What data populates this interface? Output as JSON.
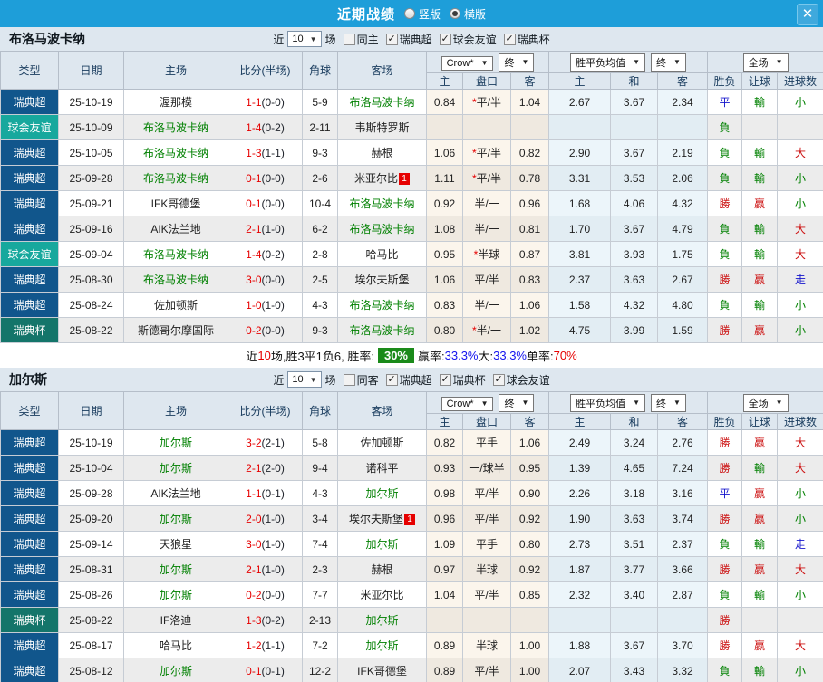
{
  "dialog": {
    "title": "近期战绩",
    "layout_options": [
      {
        "label": "竖版",
        "selected": false
      },
      {
        "label": "横版",
        "selected": true
      }
    ],
    "close_label": "✕"
  },
  "colors": {
    "titlebar": "#1e9ed9",
    "band": "#dee7ef",
    "league_super": "#11568c",
    "league_friendly": "#17a89d",
    "league_cup": "#14756a",
    "win_red": "#cc1111",
    "lose_green": "#008000",
    "draw_blue": "#1414cc",
    "rate_badge_green": "#1a8a1a"
  },
  "columns": {
    "main": [
      "类型",
      "日期",
      "主场",
      "比分(半场)",
      "角球",
      "客场"
    ],
    "crown_select": "Crow*",
    "final_select": "终",
    "avg_select": "胜平负均值",
    "full_select": "全场",
    "crown_subs": [
      "主",
      "盘口",
      "客"
    ],
    "avg_subs": [
      "主",
      "和",
      "客"
    ],
    "full_subs": [
      "胜负",
      "让球",
      "进球数"
    ]
  },
  "sections": [
    {
      "team": "布洛马波卡纳",
      "filter": {
        "prefix": "近",
        "count": "10",
        "suffix": "场",
        "checkboxes": [
          {
            "label": "同主",
            "checked": false
          },
          {
            "label": "瑞典超",
            "checked": true
          },
          {
            "label": "球会友谊",
            "checked": true
          },
          {
            "label": "瑞典杯",
            "checked": true
          }
        ]
      },
      "rows": [
        {
          "league": "瑞典超",
          "lkey": "super",
          "date": "25-10-19",
          "home": "渥那模",
          "home_green": false,
          "score": "1-1",
          "half": "(0-0)",
          "corner": "5-9",
          "away": "布洛马波卡纳",
          "away_green": true,
          "away_badge": "",
          "h1": "0.84",
          "hcp": "*平/半",
          "h2": "1.04",
          "o1": "2.67",
          "o2": "3.67",
          "o3": "2.34",
          "res": [
            [
              "平",
              "blue"
            ],
            [
              "輸",
              "green"
            ],
            [
              "小",
              "green"
            ]
          ]
        },
        {
          "league": "球会友谊",
          "lkey": "friendly",
          "date": "25-10-09",
          "home": "布洛马波卡纳",
          "home_green": true,
          "score": "1-4",
          "half": "(0-2)",
          "corner": "2-11",
          "away": "韦斯特罗斯",
          "away_green": false,
          "away_badge": "",
          "h1": "",
          "hcp": "",
          "h2": "",
          "o1": "",
          "o2": "",
          "o3": "",
          "res": [
            [
              "負",
              "green"
            ],
            [
              "",
              ""
            ],
            [
              "",
              ""
            ]
          ]
        },
        {
          "league": "瑞典超",
          "lkey": "super",
          "date": "25-10-05",
          "home": "布洛马波卡纳",
          "home_green": true,
          "score": "1-3",
          "half": "(1-1)",
          "corner": "9-3",
          "away": "赫根",
          "away_green": false,
          "away_badge": "",
          "h1": "1.06",
          "hcp": "*平/半",
          "h2": "0.82",
          "o1": "2.90",
          "o2": "3.67",
          "o3": "2.19",
          "res": [
            [
              "負",
              "green"
            ],
            [
              "輸",
              "green"
            ],
            [
              "大",
              "red"
            ]
          ]
        },
        {
          "league": "瑞典超",
          "lkey": "super",
          "date": "25-09-28",
          "home": "布洛马波卡纳",
          "home_green": true,
          "score": "0-1",
          "half": "(0-0)",
          "corner": "2-6",
          "away": "米亚尔比",
          "away_green": false,
          "away_badge": "1",
          "h1": "1.11",
          "hcp": "*平/半",
          "h2": "0.78",
          "o1": "3.31",
          "o2": "3.53",
          "o3": "2.06",
          "res": [
            [
              "負",
              "green"
            ],
            [
              "輸",
              "green"
            ],
            [
              "小",
              "green"
            ]
          ]
        },
        {
          "league": "瑞典超",
          "lkey": "super",
          "date": "25-09-21",
          "home": "IFK哥德堡",
          "home_green": false,
          "score": "0-1",
          "half": "(0-0)",
          "corner": "10-4",
          "away": "布洛马波卡纳",
          "away_green": true,
          "away_badge": "",
          "h1": "0.92",
          "hcp": "半/一",
          "h2": "0.96",
          "o1": "1.68",
          "o2": "4.06",
          "o3": "4.32",
          "res": [
            [
              "勝",
              "red"
            ],
            [
              "贏",
              "red"
            ],
            [
              "小",
              "green"
            ]
          ]
        },
        {
          "league": "瑞典超",
          "lkey": "super",
          "date": "25-09-16",
          "home": "AIK法兰地",
          "home_green": false,
          "score": "2-1",
          "half": "(1-0)",
          "corner": "6-2",
          "away": "布洛马波卡纳",
          "away_green": true,
          "away_badge": "",
          "h1": "1.08",
          "hcp": "半/一",
          "h2": "0.81",
          "o1": "1.70",
          "o2": "3.67",
          "o3": "4.79",
          "res": [
            [
              "負",
              "green"
            ],
            [
              "輸",
              "green"
            ],
            [
              "大",
              "red"
            ]
          ]
        },
        {
          "league": "球会友谊",
          "lkey": "friendly",
          "date": "25-09-04",
          "home": "布洛马波卡纳",
          "home_green": true,
          "score": "1-4",
          "half": "(0-2)",
          "corner": "2-8",
          "away": "哈马比",
          "away_green": false,
          "away_badge": "",
          "h1": "0.95",
          "hcp": "*半球",
          "h2": "0.87",
          "o1": "3.81",
          "o2": "3.93",
          "o3": "1.75",
          "res": [
            [
              "負",
              "green"
            ],
            [
              "輸",
              "green"
            ],
            [
              "大",
              "red"
            ]
          ]
        },
        {
          "league": "瑞典超",
          "lkey": "super",
          "date": "25-08-30",
          "home": "布洛马波卡纳",
          "home_green": true,
          "score": "3-0",
          "half": "(0-0)",
          "corner": "2-5",
          "away": "埃尔夫斯堡",
          "away_green": false,
          "away_badge": "",
          "h1": "1.06",
          "hcp": "平/半",
          "h2": "0.83",
          "o1": "2.37",
          "o2": "3.63",
          "o3": "2.67",
          "res": [
            [
              "勝",
              "red"
            ],
            [
              "贏",
              "red"
            ],
            [
              "走",
              "blue"
            ]
          ]
        },
        {
          "league": "瑞典超",
          "lkey": "super",
          "date": "25-08-24",
          "home": "佐加顿斯",
          "home_green": false,
          "score": "1-0",
          "half": "(1-0)",
          "corner": "4-3",
          "away": "布洛马波卡纳",
          "away_green": true,
          "away_badge": "",
          "h1": "0.83",
          "hcp": "半/一",
          "h2": "1.06",
          "o1": "1.58",
          "o2": "4.32",
          "o3": "4.80",
          "res": [
            [
              "負",
              "green"
            ],
            [
              "輸",
              "green"
            ],
            [
              "小",
              "green"
            ]
          ]
        },
        {
          "league": "瑞典杯",
          "lkey": "cup",
          "date": "25-08-22",
          "home": "斯德哥尔摩国际",
          "home_green": false,
          "score": "0-2",
          "half": "(0-0)",
          "corner": "9-3",
          "away": "布洛马波卡纳",
          "away_green": true,
          "away_badge": "",
          "h1": "0.80",
          "hcp": "*半/一",
          "h2": "1.02",
          "o1": "4.75",
          "o2": "3.99",
          "o3": "1.59",
          "res": [
            [
              "勝",
              "red"
            ],
            [
              "贏",
              "red"
            ],
            [
              "小",
              "green"
            ]
          ]
        }
      ],
      "summary": {
        "segments": [
          {
            "t": "近"
          },
          {
            "t": "10",
            "c": "red"
          },
          {
            "t": "场,胜3平1负6, 胜率:"
          },
          {
            "t": "30%",
            "badge": true
          },
          {
            "t": "赢率:"
          },
          {
            "t": "33.3%",
            "c": "blue"
          },
          {
            "t": " 大:"
          },
          {
            "t": "33.3%",
            "c": "blue"
          },
          {
            "t": " 单率:"
          },
          {
            "t": "70%",
            "c": "red"
          }
        ]
      }
    },
    {
      "team": "加尔斯",
      "filter": {
        "prefix": "近",
        "count": "10",
        "suffix": "场",
        "checkboxes": [
          {
            "label": "同客",
            "checked": false
          },
          {
            "label": "瑞典超",
            "checked": true
          },
          {
            "label": "瑞典杯",
            "checked": true
          },
          {
            "label": "球会友谊",
            "checked": true
          }
        ]
      },
      "rows": [
        {
          "league": "瑞典超",
          "lkey": "super",
          "date": "25-10-19",
          "home": "加尔斯",
          "home_green": true,
          "score": "3-2",
          "half": "(2-1)",
          "corner": "5-8",
          "away": "佐加顿斯",
          "away_green": false,
          "away_badge": "",
          "h1": "0.82",
          "hcp": "平手",
          "h2": "1.06",
          "o1": "2.49",
          "o2": "3.24",
          "o3": "2.76",
          "res": [
            [
              "勝",
              "red"
            ],
            [
              "贏",
              "red"
            ],
            [
              "大",
              "red"
            ]
          ]
        },
        {
          "league": "瑞典超",
          "lkey": "super",
          "date": "25-10-04",
          "home": "加尔斯",
          "home_green": true,
          "score": "2-1",
          "half": "(2-0)",
          "corner": "9-4",
          "away": "诺科平",
          "away_green": false,
          "away_badge": "",
          "h1": "0.93",
          "hcp": "一/球半",
          "h2": "0.95",
          "o1": "1.39",
          "o2": "4.65",
          "o3": "7.24",
          "res": [
            [
              "勝",
              "red"
            ],
            [
              "輸",
              "green"
            ],
            [
              "大",
              "red"
            ]
          ]
        },
        {
          "league": "瑞典超",
          "lkey": "super",
          "date": "25-09-28",
          "home": "AIK法兰地",
          "home_green": false,
          "score": "1-1",
          "half": "(0-1)",
          "corner": "4-3",
          "away": "加尔斯",
          "away_green": true,
          "away_badge": "",
          "h1": "0.98",
          "hcp": "平/半",
          "h2": "0.90",
          "o1": "2.26",
          "o2": "3.18",
          "o3": "3.16",
          "res": [
            [
              "平",
              "blue"
            ],
            [
              "贏",
              "red"
            ],
            [
              "小",
              "green"
            ]
          ]
        },
        {
          "league": "瑞典超",
          "lkey": "super",
          "date": "25-09-20",
          "home": "加尔斯",
          "home_green": true,
          "score": "2-0",
          "half": "(1-0)",
          "corner": "3-4",
          "away": "埃尔夫斯堡",
          "away_green": false,
          "away_badge": "1",
          "h1": "0.96",
          "hcp": "平/半",
          "h2": "0.92",
          "o1": "1.90",
          "o2": "3.63",
          "o3": "3.74",
          "res": [
            [
              "勝",
              "red"
            ],
            [
              "贏",
              "red"
            ],
            [
              "小",
              "green"
            ]
          ]
        },
        {
          "league": "瑞典超",
          "lkey": "super",
          "date": "25-09-14",
          "home": "天狼星",
          "home_green": false,
          "score": "3-0",
          "half": "(1-0)",
          "corner": "7-4",
          "away": "加尔斯",
          "away_green": true,
          "away_badge": "",
          "h1": "1.09",
          "hcp": "平手",
          "h2": "0.80",
          "o1": "2.73",
          "o2": "3.51",
          "o3": "2.37",
          "res": [
            [
              "負",
              "green"
            ],
            [
              "輸",
              "green"
            ],
            [
              "走",
              "blue"
            ]
          ]
        },
        {
          "league": "瑞典超",
          "lkey": "super",
          "date": "25-08-31",
          "home": "加尔斯",
          "home_green": true,
          "score": "2-1",
          "half": "(1-0)",
          "corner": "2-3",
          "away": "赫根",
          "away_green": false,
          "away_badge": "",
          "h1": "0.97",
          "hcp": "半球",
          "h2": "0.92",
          "o1": "1.87",
          "o2": "3.77",
          "o3": "3.66",
          "res": [
            [
              "勝",
              "red"
            ],
            [
              "贏",
              "red"
            ],
            [
              "大",
              "red"
            ]
          ]
        },
        {
          "league": "瑞典超",
          "lkey": "super",
          "date": "25-08-26",
          "home": "加尔斯",
          "home_green": true,
          "score": "0-2",
          "half": "(0-0)",
          "corner": "7-7",
          "away": "米亚尔比",
          "away_green": false,
          "away_badge": "",
          "h1": "1.04",
          "hcp": "平/半",
          "h2": "0.85",
          "o1": "2.32",
          "o2": "3.40",
          "o3": "2.87",
          "res": [
            [
              "負",
              "green"
            ],
            [
              "輸",
              "green"
            ],
            [
              "小",
              "green"
            ]
          ]
        },
        {
          "league": "瑞典杯",
          "lkey": "cup",
          "date": "25-08-22",
          "home": "IF洛迪",
          "home_green": false,
          "score": "1-3",
          "half": "(0-2)",
          "corner": "2-13",
          "away": "加尔斯",
          "away_green": true,
          "away_badge": "",
          "h1": "",
          "hcp": "",
          "h2": "",
          "o1": "",
          "o2": "",
          "o3": "",
          "res": [
            [
              "勝",
              "red"
            ],
            [
              "",
              ""
            ],
            [
              "",
              ""
            ]
          ]
        },
        {
          "league": "瑞典超",
          "lkey": "super",
          "date": "25-08-17",
          "home": "哈马比",
          "home_green": false,
          "score": "1-2",
          "half": "(1-1)",
          "corner": "7-2",
          "away": "加尔斯",
          "away_green": true,
          "away_badge": "",
          "h1": "0.89",
          "hcp": "半球",
          "h2": "1.00",
          "o1": "1.88",
          "o2": "3.67",
          "o3": "3.70",
          "res": [
            [
              "勝",
              "red"
            ],
            [
              "贏",
              "red"
            ],
            [
              "大",
              "red"
            ]
          ]
        },
        {
          "league": "瑞典超",
          "lkey": "super",
          "date": "25-08-12",
          "home": "加尔斯",
          "home_green": true,
          "score": "0-1",
          "half": "(0-1)",
          "corner": "12-2",
          "away": "IFK哥德堡",
          "away_green": false,
          "away_badge": "",
          "h1": "0.89",
          "hcp": "平/半",
          "h2": "1.00",
          "o1": "2.07",
          "o2": "3.43",
          "o3": "3.32",
          "res": [
            [
              "負",
              "green"
            ],
            [
              "輸",
              "green"
            ],
            [
              "小",
              "green"
            ]
          ]
        }
      ],
      "summary": null
    }
  ]
}
